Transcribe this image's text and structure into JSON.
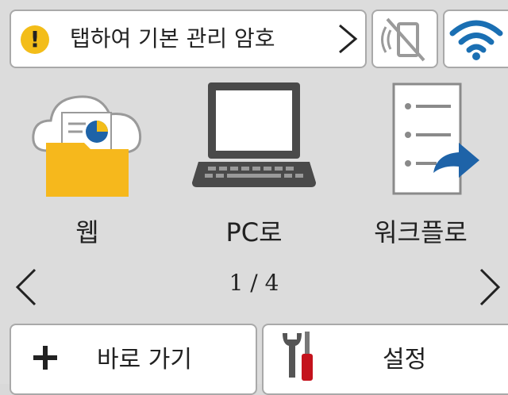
{
  "status_bar": {
    "notice_text": "탭하여 기본 관리 암호",
    "warning_icon": "!",
    "nfc_icon": "nfc-off-icon",
    "wifi_icon": "wifi-icon"
  },
  "apps": [
    {
      "label": "웹",
      "icon": "cloud-folder-icon"
    },
    {
      "label": "PC로",
      "icon": "laptop-icon"
    },
    {
      "label": "워크플로",
      "icon": "workflow-list-icon"
    }
  ],
  "pager": {
    "text": "1 / 4"
  },
  "bottom_bar": {
    "shortcut_label": "바로 가기",
    "settings_label": "설정"
  },
  "colors": {
    "background": "#dcdcdc",
    "warning": "#f3bd19",
    "folder": "#f6b81c",
    "wifi": "#1a6fb3",
    "share_arrow": "#1e63a8",
    "tool_red": "#c4121c"
  }
}
